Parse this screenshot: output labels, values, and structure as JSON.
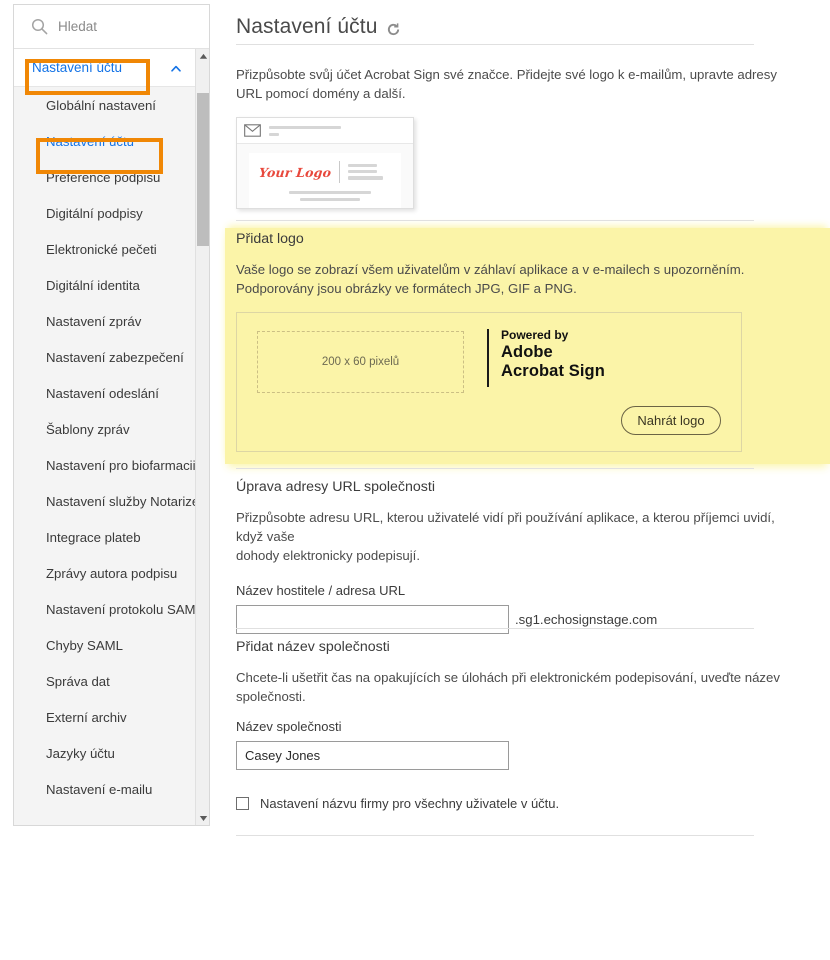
{
  "sidebar": {
    "search": {
      "placeholder": "Hledat",
      "value": "",
      "icon": "search-icon"
    },
    "group": {
      "label": "Nastavení účtu",
      "chevron": "chevron-up-icon",
      "expanded": true
    },
    "items": [
      {
        "label": "Globální nastavení",
        "selected": false
      },
      {
        "label": "Nastavení účtu",
        "selected": true
      },
      {
        "label": "Preference podpisu",
        "selected": false
      },
      {
        "label": "Digitální podpisy",
        "selected": false
      },
      {
        "label": "Elektronické pečeti",
        "selected": false
      },
      {
        "label": "Digitální identita",
        "selected": false
      },
      {
        "label": "Nastavení zpráv",
        "selected": false
      },
      {
        "label": "Nastavení zabezpečení",
        "selected": false
      },
      {
        "label": "Nastavení odeslání",
        "selected": false
      },
      {
        "label": "Šablony zpráv",
        "selected": false
      },
      {
        "label": "Nastavení pro biofarmacii",
        "selected": false
      },
      {
        "label": "Nastavení služby Notarize",
        "selected": false
      },
      {
        "label": "Integrace plateb",
        "selected": false
      },
      {
        "label": "Zprávy autora podpisu",
        "selected": false
      },
      {
        "label": "Nastavení protokolu SAML",
        "selected": false
      },
      {
        "label": "Chyby SAML",
        "selected": false
      },
      {
        "label": "Správa dat",
        "selected": false
      },
      {
        "label": "Externí archiv",
        "selected": false
      },
      {
        "label": "Jazyky účtu",
        "selected": false
      },
      {
        "label": "Nastavení e-mailu",
        "selected": false
      }
    ],
    "scrollbar": {
      "up_arrow": "caret-up-icon",
      "down_arrow": "caret-down-icon"
    }
  },
  "annotations": {
    "color": "#f08705",
    "boxes": [
      "nav-group-nastaveni-uctu",
      "nav-item-nastaveni-uctu"
    ]
  },
  "main": {
    "title": "Nastavení účtu",
    "refresh_icon": "refresh-icon",
    "intro": "Přizpůsobte svůj účet Acrobat Sign své značce. Přidejte své logo k e-mailům, upravte adresy URL pomocí domény a další.",
    "preview": {
      "icon": "envelope-icon",
      "logo_text": "Your Logo"
    },
    "logo_section": {
      "highlighted": true,
      "highlight_color": "#fbf4a8",
      "title": "Přidat logo",
      "desc_line1": "Vaše logo se zobrazí všem uživatelům v záhlaví aplikace a v e-mailech s upozorněním.",
      "desc_line2": "Podporovány jsou obrázky ve formátech JPG, GIF a PNG.",
      "dropzone_label": "200 x 60 pixelů",
      "powered_by": "Powered by",
      "brand_line1": "Adobe",
      "brand_line2": "Acrobat Sign",
      "upload_button": "Nahrát logo"
    },
    "url_section": {
      "title": "Úprava adresy URL společnosti",
      "desc_line1": "Přizpůsobte adresu URL, kterou uživatelé vidí při používání aplikace, a kterou příjemci uvidí, když vaše",
      "desc_line2": "dohody elektronicky podepisují.",
      "field_label": "Název hostitele / adresa URL",
      "field_value": "",
      "field_placeholder": "",
      "suffix": ".sg1.echosignstage.com"
    },
    "company_section": {
      "title": "Přidat název společnosti",
      "desc": "Chcete-li ušetřit čas na opakujících se úlohách při elektronickém podepisování, uveďte název společnosti.",
      "field_label": "Název společnosti",
      "field_value": "Casey Jones",
      "checkbox_label": "Nastavení názvu firmy pro všechny uživatele v účtu.",
      "checkbox_checked": false
    }
  }
}
